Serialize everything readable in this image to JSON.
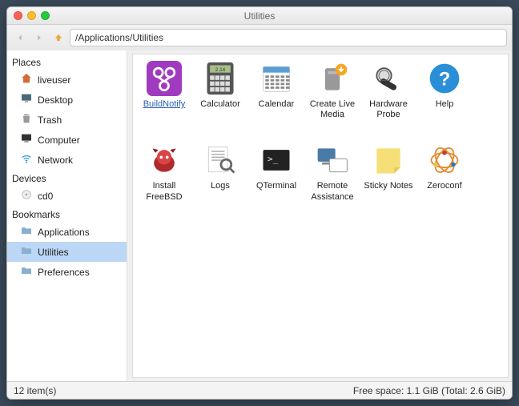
{
  "window": {
    "title": "Utilities"
  },
  "path": {
    "value": "/Applications/Utilities"
  },
  "sidebar": {
    "sections": {
      "places": "Places",
      "devices": "Devices",
      "bookmarks": "Bookmarks"
    },
    "places": [
      {
        "label": "liveuser",
        "icon": "home"
      },
      {
        "label": "Desktop",
        "icon": "desktop"
      },
      {
        "label": "Trash",
        "icon": "trash"
      },
      {
        "label": "Computer",
        "icon": "computer"
      },
      {
        "label": "Network",
        "icon": "network"
      }
    ],
    "devices": [
      {
        "label": "cd0",
        "icon": "disc"
      }
    ],
    "bookmarks": [
      {
        "label": "Applications",
        "icon": "folder"
      },
      {
        "label": "Utilities",
        "icon": "folder",
        "selected": true
      },
      {
        "label": "Preferences",
        "icon": "folder"
      }
    ]
  },
  "items": [
    {
      "label": "BuildNotify",
      "icon": "buildnotify",
      "selected": true
    },
    {
      "label": "Calculator",
      "icon": "calculator"
    },
    {
      "label": "Calendar",
      "icon": "calendar"
    },
    {
      "label": "Create Live Media",
      "icon": "createmedia"
    },
    {
      "label": "Hardware Probe",
      "icon": "probe"
    },
    {
      "label": "Help",
      "icon": "help"
    },
    {
      "label": "Install FreeBSD",
      "icon": "installbsd"
    },
    {
      "label": "Logs",
      "icon": "logs"
    },
    {
      "label": "QTerminal",
      "icon": "terminal"
    },
    {
      "label": "Remote Assistance",
      "icon": "remote"
    },
    {
      "label": "Sticky Notes",
      "icon": "sticky"
    },
    {
      "label": "Zeroconf",
      "icon": "zeroconf"
    }
  ],
  "status": {
    "items": "12 item(s)",
    "space": "Free space: 1.1 GiB (Total: 2.6 GiB)"
  }
}
